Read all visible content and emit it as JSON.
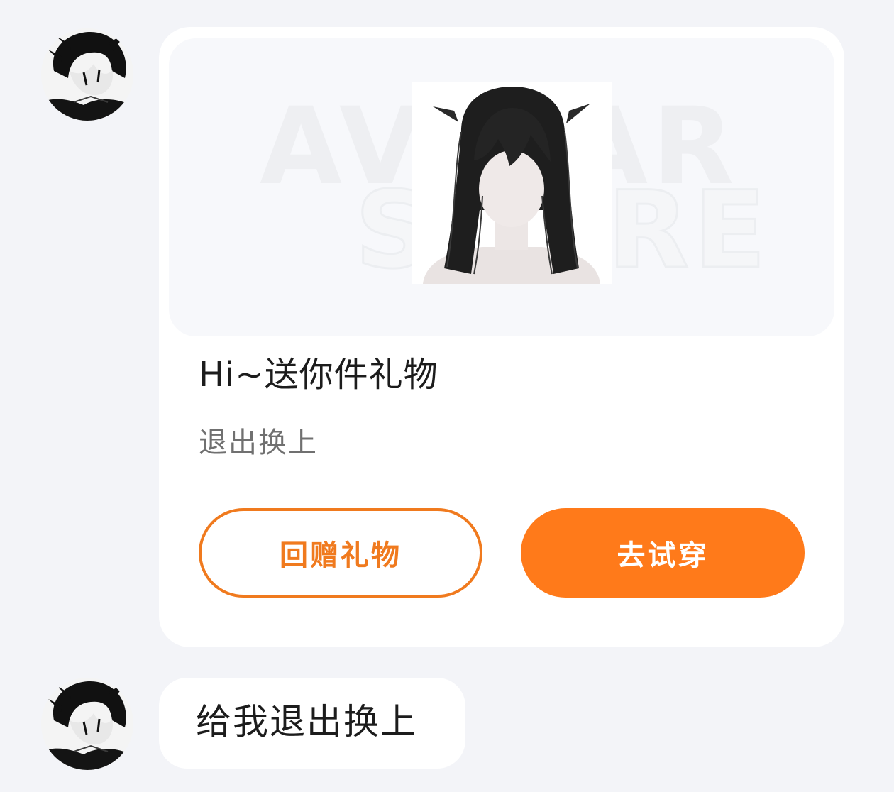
{
  "chat": {
    "gift_message": {
      "banner_watermark": [
        "AVATAR",
        "STORE"
      ],
      "item_image": "long-black-hair-accessory",
      "title": "Hi~送你件礼物",
      "item_name": "退出换上",
      "buttons": {
        "return_gift": "回赠礼物",
        "try_on": "去试穿"
      }
    },
    "text_message": {
      "text": "给我退出换上"
    },
    "sender_avatar": "anime-boy-avatar"
  },
  "colors": {
    "accent": "#ff7a1a",
    "outline_button": "#f07a1e",
    "background": "#f3f4f8",
    "bubble": "#ffffff"
  }
}
